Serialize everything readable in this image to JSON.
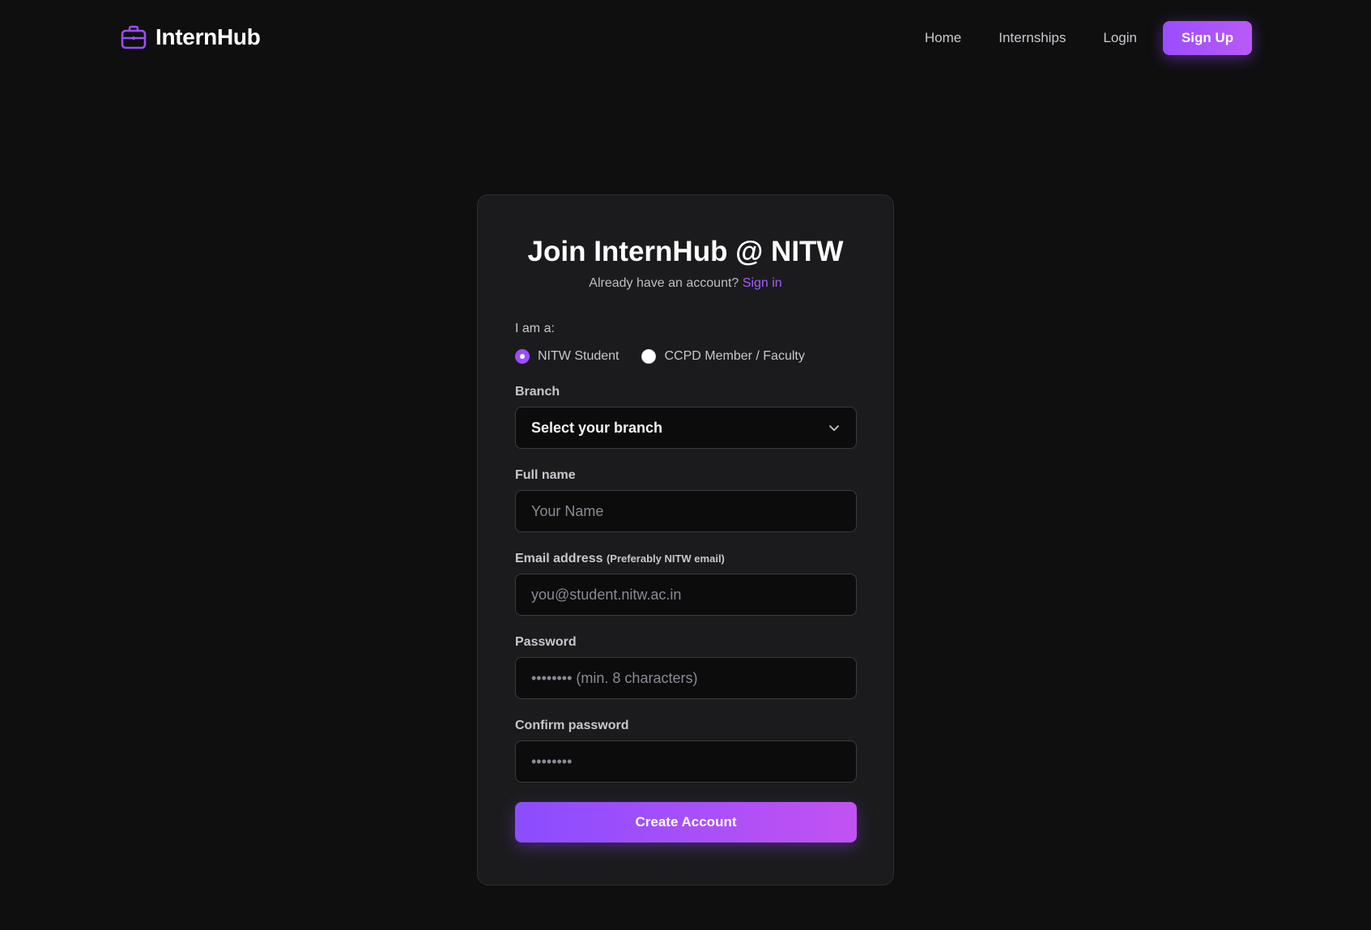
{
  "nav": {
    "brand": "InternHub",
    "links": [
      "Home",
      "Internships",
      "Login"
    ],
    "signup_label": "Sign Up"
  },
  "card": {
    "title": "Join InternHub @ NITW",
    "subtitle": "Already have an account?",
    "signin_label": "Sign in"
  },
  "form": {
    "role_label": "I am a:",
    "roles": [
      "NITW Student",
      "CCPD Member / Faculty"
    ],
    "selected_role": "NITW Student",
    "branch_label": "Branch",
    "branch_value": "Select your branch",
    "fullname_label": "Full name",
    "fullname_placeholder": "Your Name",
    "email_label": "Email address",
    "email_note": "(Preferably NITW email)",
    "email_placeholder": "you@student.nitw.ac.in",
    "password_label": "Password",
    "password_placeholder": "•••••••• (min. 8 characters)",
    "confirm_label": "Confirm password",
    "confirm_placeholder": "••••••••",
    "submit_label": "Create Account"
  },
  "colors": {
    "accent": "#9b4dff",
    "background": "#0f0f0f",
    "card": "#1b1b1d"
  },
  "icons": {
    "brand": "briefcase-icon",
    "select": "chevron-down-icon"
  }
}
